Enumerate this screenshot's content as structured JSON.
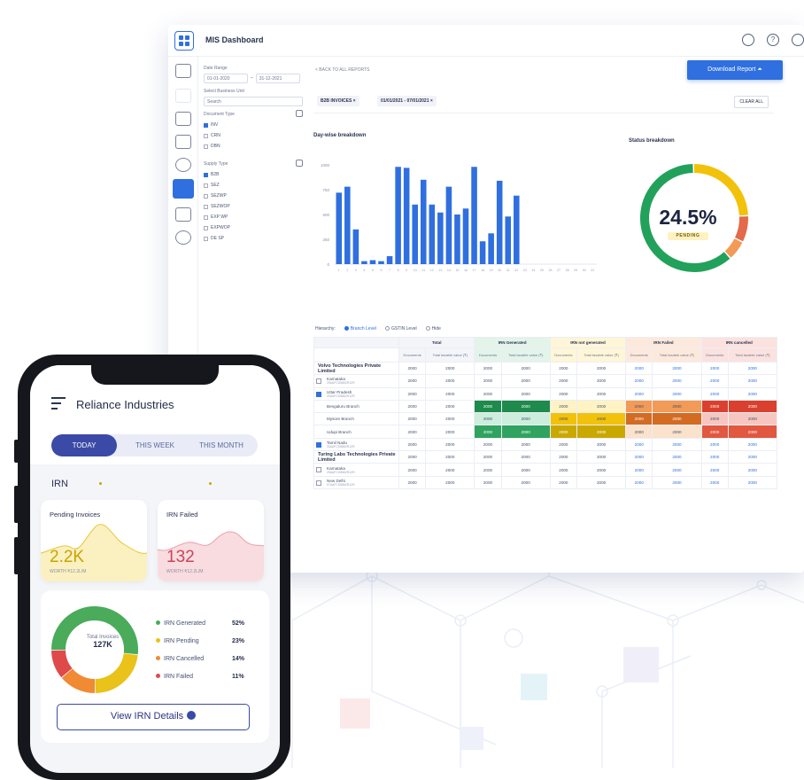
{
  "dashboard": {
    "title": "MIS Dashboard",
    "download_label": "Download Report",
    "back_link": "< BACK TO ALL REPORTS",
    "chips": [
      "B2B INVOICES ×",
      "01/01/2021 - 07/01/2021 ×"
    ],
    "clear_all": "CLEAR ALL",
    "filters": {
      "date_range_label": "Date Range",
      "date_from": "01-01-2020",
      "date_to": "31-12-2021",
      "business_unit_label": "Select Business Unit",
      "search_placeholder": "Search",
      "document_type_label": "Document Type",
      "document_types": [
        "INV",
        "CRN",
        "DBN"
      ],
      "supply_type_label": "Supply Type",
      "supply_types": [
        "B2B",
        "SEZ",
        "SEZWP",
        "SEZWOP",
        "EXP WP",
        "EXPWOP",
        "DE SP"
      ]
    },
    "daywise_title": "Day-wise breakdown",
    "status_title": "Status breakdown",
    "status_pct": "24.5%",
    "status_badge": "PENDING",
    "view_legend": {
      "label": "Hierarchy:",
      "options": [
        "Branch Level",
        "GSTIN Level",
        "Hide"
      ]
    },
    "table": {
      "groups": [
        "Total",
        "IRN Generated",
        "IRN not generated",
        "IRN Failed",
        "IRN cancelled"
      ],
      "sub_headers": [
        "Documents",
        "Total taxable value (₹)"
      ],
      "rows": [
        {
          "name": "Volvo Technologies Private Limited",
          "type": "company",
          "cells": [
            "2000",
            "2000",
            "2000",
            "2000",
            "2000",
            "2000",
            "2000",
            "2000",
            "2000",
            "2000"
          ]
        },
        {
          "name": "Karnataka",
          "gstin": "29AAFCD5862R1ZR",
          "type": "state",
          "checked": false,
          "cells": [
            "2000",
            "2000",
            "2000",
            "2000",
            "2000",
            "2000",
            "2000",
            "2000",
            "2000",
            "2000"
          ]
        },
        {
          "name": "Uttar Pradesh",
          "gstin": "09AAFCD5862R1ZR",
          "type": "state",
          "checked": true,
          "cells": [
            "2000",
            "2000",
            "2000",
            "2000",
            "2000",
            "2000",
            "2000",
            "2000",
            "2000",
            "2000"
          ]
        },
        {
          "name": "Bengaluru Branch",
          "type": "branch",
          "cells": [
            "2000",
            "2000",
            "2000",
            "2000",
            "2000",
            "2000",
            "2000",
            "2000",
            "2000",
            "2000"
          ]
        },
        {
          "name": "Mysore Branch",
          "type": "branch",
          "cells": [
            "2000",
            "2000",
            "2000",
            "2000",
            "2000",
            "2000",
            "2000",
            "2000",
            "2000",
            "2000"
          ]
        },
        {
          "name": "Udupi Branch",
          "type": "branch",
          "cells": [
            "2000",
            "2000",
            "2000",
            "2000",
            "2000",
            "2000",
            "2000",
            "2000",
            "2000",
            "2000"
          ]
        },
        {
          "name": "Tamil Nadu",
          "gstin": "33AAFCD5862R1ZR",
          "type": "state",
          "checked": true,
          "cells": [
            "2000",
            "2000",
            "2000",
            "2000",
            "2000",
            "2000",
            "2000",
            "2000",
            "2000",
            "2000"
          ]
        },
        {
          "name": "Turing Labs Technologies Private Limited",
          "type": "company",
          "cells": [
            "2000",
            "2000",
            "2000",
            "2000",
            "2000",
            "2000",
            "2000",
            "2000",
            "2000",
            "2000"
          ]
        },
        {
          "name": "Karnataka",
          "gstin": "29AAFCD5862R1ZR",
          "type": "state",
          "checked": false,
          "cells": [
            "2000",
            "2000",
            "2000",
            "2000",
            "2000",
            "2000",
            "2000",
            "2000",
            "2000",
            "2000"
          ]
        },
        {
          "name": "New Delhi",
          "gstin": "07AAFCD5862R1ZR",
          "type": "state",
          "checked": false,
          "cells": [
            "2000",
            "2000",
            "2000",
            "2000",
            "2000",
            "2000",
            "2000",
            "2000",
            "2000",
            "2000"
          ]
        }
      ],
      "heat": {
        "3": [
          "",
          "",
          "#1e8a4c",
          "#1e8a4c",
          "#fff3c4",
          "#fff3c4",
          "#f29a57",
          "#f29a57",
          "#d9412e",
          "#d9412e"
        ],
        "4": [
          "",
          "",
          "#cdeedd",
          "#cdeedd",
          "#f2c20a",
          "#f2c20a",
          "#d36b22",
          "#d36b22",
          "#f7c6c0",
          "#f7c6c0"
        ],
        "5": [
          "",
          "",
          "#2fa35f",
          "#2fa35f",
          "#c9a800",
          "#c9a800",
          "#fbe2cc",
          "#fbe2cc",
          "#e2573f",
          "#e2573f"
        ]
      }
    }
  },
  "chart_data": [
    {
      "type": "bar",
      "title": "Day-wise breakdown",
      "categories": [
        "1",
        "2",
        "3",
        "4",
        "5",
        "6",
        "7",
        "8",
        "9",
        "10",
        "11",
        "12",
        "13",
        "14",
        "15",
        "16",
        "17",
        "18",
        "19",
        "20",
        "21",
        "22",
        "23",
        "24",
        "25",
        "26",
        "27",
        "28",
        "29",
        "30",
        "31"
      ],
      "values": [
        720,
        780,
        350,
        30,
        40,
        30,
        80,
        980,
        970,
        600,
        850,
        600,
        520,
        780,
        500,
        560,
        980,
        230,
        310,
        840,
        480,
        690,
        0,
        0,
        0,
        0,
        0,
        0,
        0,
        0,
        0
      ],
      "yticks": [
        "1000",
        "750",
        "500",
        "250",
        "0"
      ],
      "ylim": [
        0,
        1000
      ],
      "color": "#2f6fe0"
    },
    {
      "type": "pie",
      "title": "Status breakdown",
      "values": [
        24.5,
        8,
        6,
        61.5
      ],
      "colors": [
        "#f2c20a",
        "#e36a4a",
        "#f29a57",
        "#22a15a"
      ]
    },
    {
      "type": "pie",
      "categories": [
        "IRN Generated",
        "IRN Pending",
        "IRN Cancelled",
        "IRN Failed"
      ],
      "values": [
        52,
        23,
        14,
        11
      ],
      "colors": [
        "#4aab5a",
        "#e9c21a",
        "#f08a34",
        "#de4a4a"
      ]
    }
  ],
  "mobile": {
    "company": "Reliance Industries",
    "tabs": [
      "TODAY",
      "THIS WEEK",
      "THIS MONTH"
    ],
    "section": "IRN",
    "cards": [
      {
        "title": "Pending Invoices",
        "value": "2.2K",
        "sub": "WORTH ₹12.2L/M",
        "color": "#c9a400"
      },
      {
        "title": "IRN Failed",
        "value": "132",
        "sub": "WORTH ₹12.2L/M",
        "color": "#c9455a"
      }
    ],
    "donut_center": {
      "label": "Total Invoices",
      "value": "127K"
    },
    "legend": [
      {
        "label": "IRN Generated",
        "pct": "52%",
        "color": "#4aab5a"
      },
      {
        "label": "IRN Pending",
        "pct": "23%",
        "color": "#e9c21a"
      },
      {
        "label": "IRN Cancelled",
        "pct": "14%",
        "color": "#f08a34"
      },
      {
        "label": "IRN Failed",
        "pct": "11%",
        "color": "#de4a4a"
      }
    ],
    "view_button": "View IRN Details"
  }
}
